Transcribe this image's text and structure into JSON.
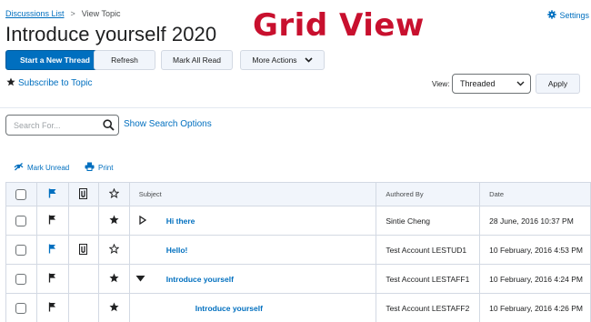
{
  "breadcrumb": {
    "parent": "Discussions List",
    "separator": ">",
    "current": "View Topic"
  },
  "settings": {
    "label": "Settings",
    "icon": "gear-icon"
  },
  "page_title": "Introduce yourself 2020",
  "overlay_title": "Grid View",
  "toolbar": {
    "start_thread": "Start a New Thread",
    "refresh": "Refresh",
    "mark_all_read": "Mark All Read",
    "more_actions": "More Actions"
  },
  "subscribe": {
    "label": "Subscribe to Topic",
    "icon": "star-icon"
  },
  "view": {
    "label": "View:",
    "selected": "Threaded",
    "apply": "Apply"
  },
  "search": {
    "placeholder": "Search For...",
    "value": "",
    "options_label": "Show Search Options"
  },
  "actions": {
    "mark_unread": "Mark Unread",
    "print": "Print"
  },
  "table": {
    "columns": {
      "subject": "Subject",
      "authored_by": "Authored By",
      "date": "Date"
    },
    "rows": [
      {
        "subject": "Hi there",
        "author": "Sintie Cheng",
        "date": "28 June, 2016 10:37 PM",
        "flag_colored": false,
        "attachment": false,
        "starred": true,
        "expander": "collapsed",
        "indent": 0
      },
      {
        "subject": "Hello!",
        "author": "Test Account LESTUD1",
        "date": "10 February, 2016 4:53 PM",
        "flag_colored": true,
        "attachment": true,
        "starred": false,
        "expander": "none",
        "indent": 0
      },
      {
        "subject": "Introduce yourself",
        "author": "Test Account LESTAFF1",
        "date": "10 February, 2016 4:24 PM",
        "flag_colored": false,
        "attachment": false,
        "starred": true,
        "expander": "expanded",
        "indent": 0
      },
      {
        "subject": "Introduce yourself",
        "author": "Test Account LESTAFF2",
        "date": "10 February, 2016 4:26 PM",
        "flag_colored": false,
        "attachment": false,
        "starred": true,
        "expander": "none",
        "indent": 1
      }
    ]
  },
  "colors": {
    "link": "#006fbf",
    "primary_button": "#006fbf",
    "overlay_title": "#c8102e",
    "flag_blue": "#006fbf"
  }
}
